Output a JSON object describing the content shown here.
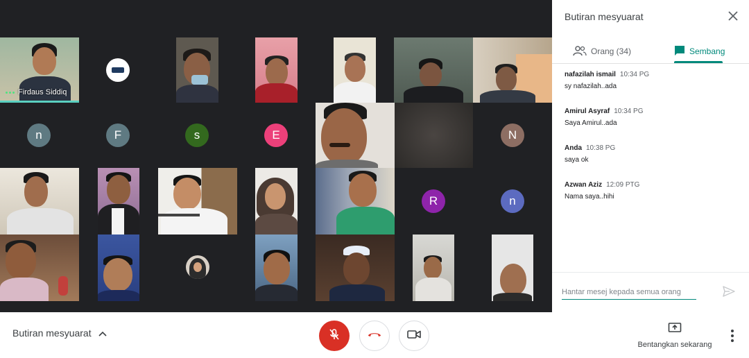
{
  "panel": {
    "title": "Butiran mesyuarat",
    "tabs": {
      "people_label": "Orang (34)",
      "chat_label": "Sembang"
    },
    "messages": [
      {
        "sender": "nafazilah ismail",
        "time": "10:34 PG",
        "text": "sy nafazilah..ada"
      },
      {
        "sender": "Amirul Asyraf",
        "time": "10:34 PG",
        "text": "Saya Amirul..ada"
      },
      {
        "sender": "Anda",
        "time": "10:38 PG",
        "text": "saya ok"
      },
      {
        "sender": "Azwan Aziz",
        "time": "12:09 PTG",
        "text": "Nama saya..hihi"
      }
    ],
    "compose_placeholder": "Hantar mesej kepada semua orang"
  },
  "stage": {
    "self_name": "Firdaus Siddiq",
    "avatars": [
      {
        "letter": "n",
        "color": "#5f7a82"
      },
      {
        "letter": "F",
        "color": "#5f7a82"
      },
      {
        "letter": "s",
        "color": "#33691e"
      },
      {
        "letter": "E",
        "color": "#ec407a"
      },
      {
        "letter": "N",
        "color": "#8d6e63"
      },
      {
        "letter": "R",
        "color": "#8e24aa"
      },
      {
        "letter": "n",
        "color": "#5c6bc0"
      }
    ]
  },
  "bottom_bar": {
    "details_label": "Butiran mesyuarat",
    "present_label": "Bentangkan sekarang"
  },
  "icons": {
    "close": "close-icon",
    "people": "people-icon",
    "chat": "chat-icon",
    "send": "send-icon",
    "chevron": "chevron-up-icon",
    "mic_off": "mic-off-icon",
    "hang_up": "phone-hangup-icon",
    "camera": "videocam-icon",
    "present": "present-screen-icon",
    "more": "more-vert-icon"
  },
  "colors": {
    "accent": "#00897b",
    "danger": "#d93025",
    "stage_bg": "#202124"
  }
}
